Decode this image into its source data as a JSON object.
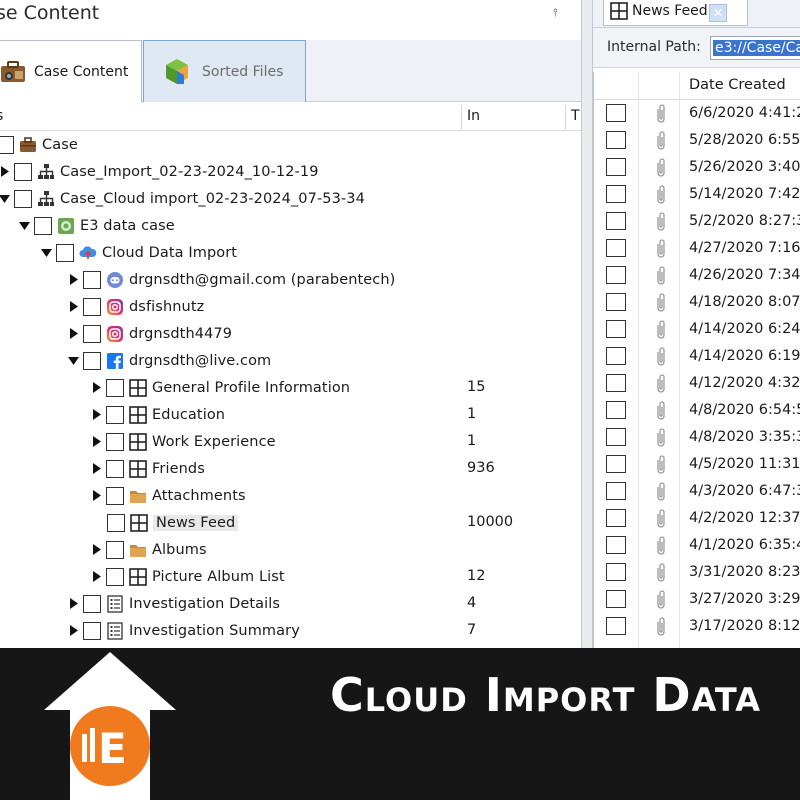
{
  "left_panel": {
    "title": "se Content",
    "tabs": [
      {
        "label": "Case Content",
        "icon": "case-content-icon",
        "active": true
      },
      {
        "label": "Sorted Files",
        "icon": "sorted-files-icon",
        "active": false
      }
    ],
    "columns": {
      "name": "s",
      "in": "In",
      "t": "T"
    },
    "tree": [
      {
        "label": "Case",
        "count": "",
        "icon": "briefcase-icon",
        "expander": "none"
      },
      {
        "label": "Case_Import_02-23-2024_10-12-19",
        "count": "",
        "icon": "hierarchy-icon",
        "expander": "collapsed"
      },
      {
        "label": "Case_Cloud import_02-23-2024_07-53-34",
        "count": "",
        "icon": "hierarchy-icon",
        "expander": "expanded"
      },
      {
        "label": "E3 data case",
        "count": "",
        "icon": "data-case-icon",
        "expander": "expanded"
      },
      {
        "label": "Cloud Data Import",
        "count": "",
        "icon": "cloud-icon",
        "expander": "expanded"
      },
      {
        "label": "drgnsdth@gmail.com (parabentech)",
        "count": "",
        "icon": "discord-icon",
        "expander": "collapsed"
      },
      {
        "label": "dsfishnutz",
        "count": "",
        "icon": "instagram-icon",
        "expander": "collapsed"
      },
      {
        "label": "drgnsdth4479",
        "count": "",
        "icon": "instagram-icon",
        "expander": "collapsed"
      },
      {
        "label": "drgnsdth@live.com",
        "count": "",
        "icon": "facebook-icon",
        "expander": "expanded"
      },
      {
        "label": "General Profile Information",
        "count": "15",
        "icon": "grid-icon",
        "expander": "collapsed"
      },
      {
        "label": "Education",
        "count": "1",
        "icon": "grid-icon",
        "expander": "collapsed"
      },
      {
        "label": "Work Experience",
        "count": "1",
        "icon": "grid-icon",
        "expander": "collapsed"
      },
      {
        "label": "Friends",
        "count": "936",
        "icon": "grid-icon",
        "expander": "collapsed"
      },
      {
        "label": "Attachments",
        "count": "",
        "icon": "folder-icon",
        "expander": "collapsed"
      },
      {
        "label": "News Feed",
        "count": "10000",
        "icon": "grid-icon",
        "expander": "none",
        "selected": true
      },
      {
        "label": "Albums",
        "count": "",
        "icon": "folder-icon",
        "expander": "collapsed"
      },
      {
        "label": "Picture Album List",
        "count": "12",
        "icon": "grid-icon",
        "expander": "collapsed"
      },
      {
        "label": "Investigation Details",
        "count": "4",
        "icon": "list-icon",
        "expander": "collapsed"
      },
      {
        "label": "Investigation Summary",
        "count": "7",
        "icon": "list-icon",
        "expander": "collapsed"
      }
    ]
  },
  "right_panel": {
    "tab_label": "News Feed",
    "internal_path_label": "Internal Path:",
    "internal_path_value": "e3://Case/Ca",
    "column_header": "Date Created",
    "rows": [
      "6/6/2020  4:41:2",
      "5/28/2020  6:55:",
      "5/26/2020  3:40:",
      "5/14/2020  7:42:",
      "5/2/2020  8:27:3",
      "4/27/2020  7:16:",
      "4/26/2020  7:34:",
      "4/18/2020  8:07:",
      "4/14/2020  6:24:",
      "4/14/2020  6:19:",
      "4/12/2020  4:32:",
      "4/8/2020  6:54:5",
      "4/8/2020  3:35:3",
      "4/5/2020  11:31:",
      "4/3/2020  6:47:3",
      "4/2/2020  12:37:",
      "4/1/2020  6:35:4",
      "3/31/2020  8:23:",
      "3/27/2020  3:29:",
      "3/17/2020  8:12:"
    ]
  },
  "banner": {
    "title": "Cloud Import Data",
    "logo_letter": "E",
    "colors": {
      "background": "#161616",
      "logo_orange": "#f07a1e",
      "text": "#ffffff"
    }
  }
}
